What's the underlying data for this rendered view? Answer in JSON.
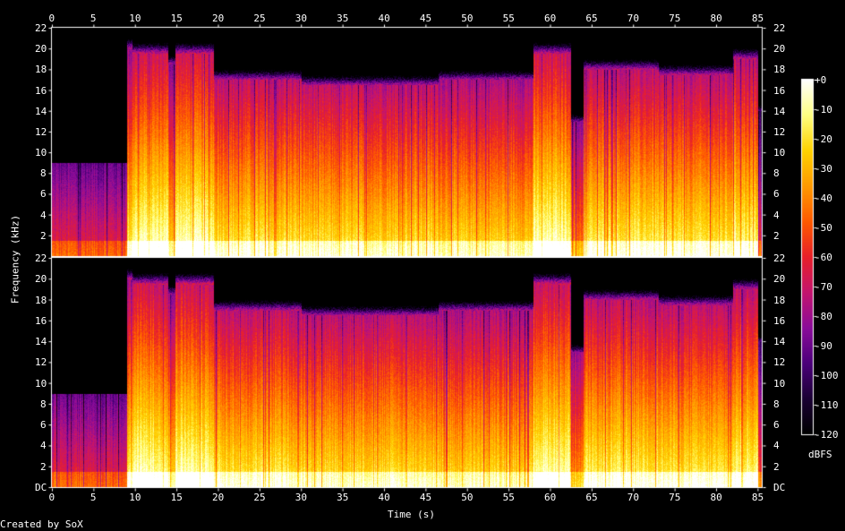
{
  "credit": "Created by SoX",
  "chart_data": {
    "type": "heatmap",
    "xlabel": "Time (s)",
    "ylabel": "Frequency (kHz)",
    "x_ticks": [
      "0",
      "5",
      "10",
      "15",
      "20",
      "25",
      "30",
      "35",
      "40",
      "45",
      "50",
      "55",
      "60",
      "65",
      "70",
      "75",
      "80",
      "85"
    ],
    "xlim": [
      0,
      85.5
    ],
    "y_ticks_top": [
      "22",
      "20",
      "18",
      "16",
      "14",
      "12",
      "10",
      "8",
      "6",
      "4",
      "2"
    ],
    "y_ticks_bottom": [
      "22",
      "20",
      "18",
      "16",
      "14",
      "12",
      "10",
      "8",
      "6",
      "4",
      "2",
      "DC"
    ],
    "ylim_khz": [
      0,
      22
    ],
    "channels": 2,
    "colorbar": {
      "label": "dBFS",
      "ticks": [
        "+0",
        "-10",
        "-20",
        "-30",
        "-40",
        "-50",
        "-60",
        "-70",
        "-80",
        "-90",
        "-100",
        "-110",
        "-120"
      ],
      "range": [
        -120,
        0
      ]
    },
    "colormap": [
      "#000000",
      "#1a0033",
      "#4b007a",
      "#8a0c9a",
      "#c4146f",
      "#e8202a",
      "#ff5a00",
      "#ff9a00",
      "#ffd200",
      "#ffff80",
      "#ffffff"
    ],
    "segments": [
      {
        "start": 0,
        "end": 9.0,
        "top_khz": 9.0,
        "level": 0.32
      },
      {
        "start": 9.0,
        "end": 9.6,
        "top_khz": 20.0,
        "level": 0.72
      },
      {
        "start": 9.6,
        "end": 14.0,
        "top_khz": 19.5,
        "level": 0.8
      },
      {
        "start": 14.0,
        "end": 14.8,
        "top_khz": 18.5,
        "level": 0.66
      },
      {
        "start": 14.8,
        "end": 19.5,
        "top_khz": 19.5,
        "level": 0.8
      },
      {
        "start": 19.5,
        "end": 30.0,
        "top_khz": 17.0,
        "level": 0.7
      },
      {
        "start": 30.0,
        "end": 46.5,
        "top_khz": 16.5,
        "level": 0.68
      },
      {
        "start": 46.5,
        "end": 58.0,
        "top_khz": 17.0,
        "level": 0.66
      },
      {
        "start": 58.0,
        "end": 62.5,
        "top_khz": 19.5,
        "level": 0.8
      },
      {
        "start": 62.5,
        "end": 64.0,
        "top_khz": 13.0,
        "level": 0.5
      },
      {
        "start": 64.0,
        "end": 73.0,
        "top_khz": 18.0,
        "level": 0.72
      },
      {
        "start": 73.0,
        "end": 82.0,
        "top_khz": 17.5,
        "level": 0.7
      },
      {
        "start": 82.0,
        "end": 85.0,
        "top_khz": 19.0,
        "level": 0.76
      },
      {
        "start": 85.0,
        "end": 85.5,
        "top_khz": 14.0,
        "level": 0.4
      }
    ]
  }
}
